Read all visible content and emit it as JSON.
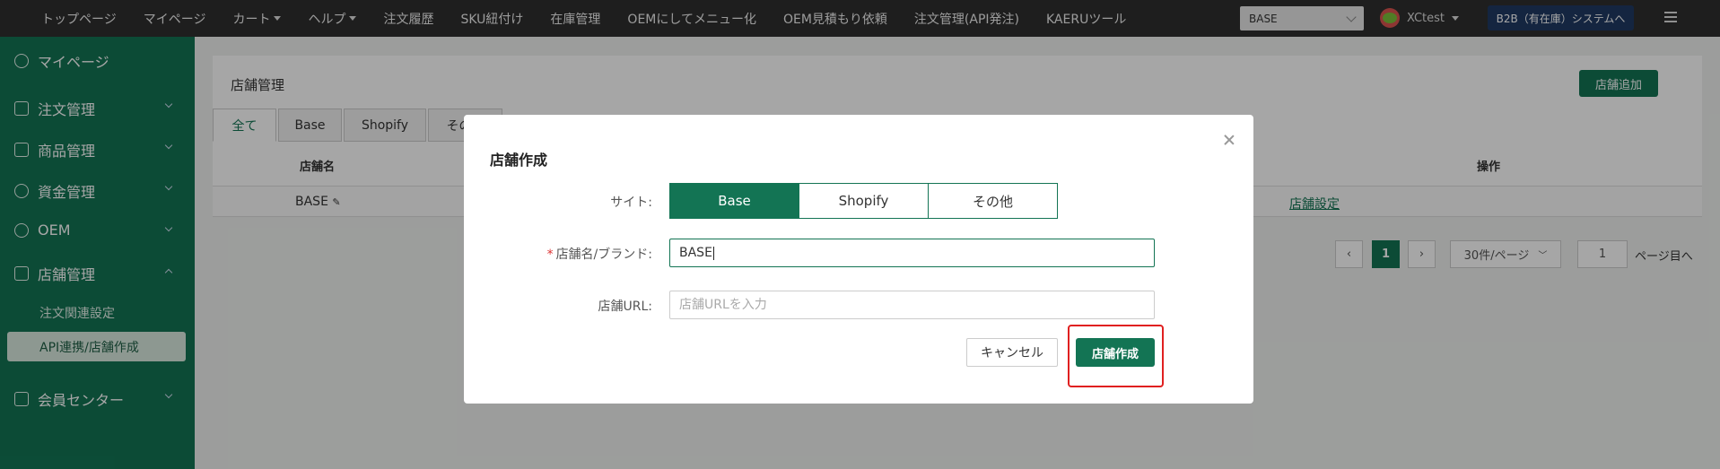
{
  "topnav": {
    "items": [
      {
        "label": "トップページ",
        "dropdown": false
      },
      {
        "label": "マイページ",
        "dropdown": false
      },
      {
        "label": "カート",
        "dropdown": true
      },
      {
        "label": "ヘルプ",
        "dropdown": true
      },
      {
        "label": "注文履歴",
        "dropdown": false
      },
      {
        "label": "SKU紐付け",
        "dropdown": false
      },
      {
        "label": "在庫管理",
        "dropdown": false
      },
      {
        "label": "OEMにしてメニュー化",
        "dropdown": false
      },
      {
        "label": "OEM見積もり依頼",
        "dropdown": false
      },
      {
        "label": "注文管理(API発注)",
        "dropdown": false
      },
      {
        "label": "KAERUツール",
        "dropdown": false
      }
    ],
    "store_select": "BASE",
    "user_name": "XCtest",
    "b2b_button": "B2B（有在庫）システムへ"
  },
  "sidebar": {
    "items": [
      {
        "label": "マイページ",
        "icon": "chart-icon"
      },
      {
        "label": "注文管理",
        "icon": "document-icon"
      },
      {
        "label": "商品管理",
        "icon": "bag-icon"
      },
      {
        "label": "資金管理",
        "icon": "yen-icon"
      },
      {
        "label": "OEM",
        "icon": "badge-icon"
      },
      {
        "label": "店舗管理",
        "icon": "store-icon"
      },
      {
        "label": "会員センター",
        "icon": "crown-icon"
      }
    ],
    "sub_items": [
      "注文関連設定",
      "API連携/店舗作成"
    ]
  },
  "main": {
    "title": "店舗管理",
    "add_button": "店舗追加",
    "tabs": [
      "全て",
      "Base",
      "Shopify",
      "その他"
    ],
    "columns": [
      "店舗名",
      "操作"
    ],
    "row": {
      "name": "BASE",
      "action": "店舗設定"
    },
    "pagination": {
      "current": "1",
      "page_size": "30件/ページ",
      "jump_value": "1",
      "jump_suffix": "ページ目へ"
    }
  },
  "modal": {
    "title": "店舗作成",
    "site_label": "サイト:",
    "site_options": [
      "Base",
      "Shopify",
      "その他"
    ],
    "site_selected": "Base",
    "name_label": "店舗名/ブランド:",
    "name_value": "BASE",
    "url_label": "店舗URL:",
    "url_placeholder": "店舗URLを入力",
    "cancel_label": "キャンセル",
    "create_label": "店舗作成"
  },
  "colors": {
    "brand": "#137454",
    "topbar": "#2f2f2f",
    "highlight": "#e02020"
  }
}
